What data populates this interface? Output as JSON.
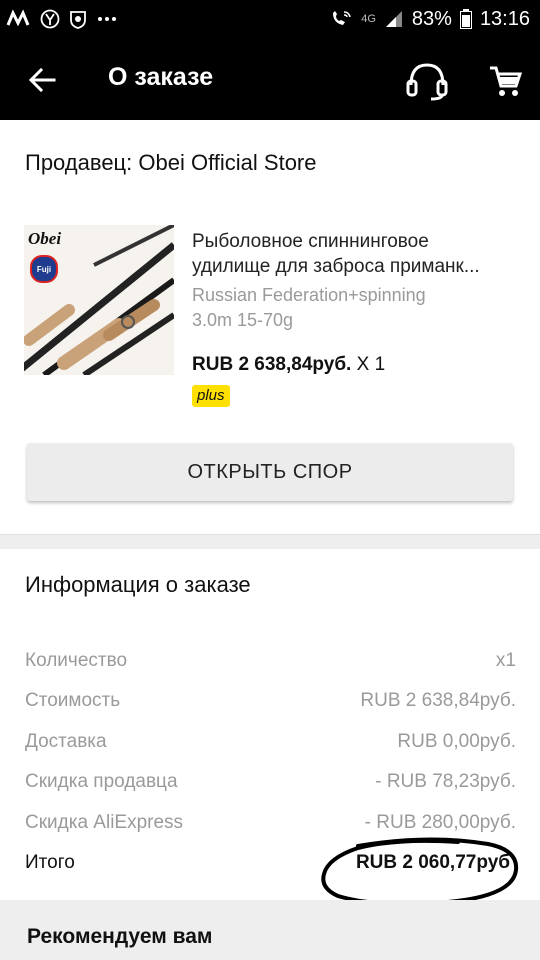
{
  "status_bar": {
    "battery": "83%",
    "time": "13:16",
    "network": "4G"
  },
  "app_bar": {
    "title": "О заказе"
  },
  "seller": {
    "label": "Продавец: Obei Official Store"
  },
  "product": {
    "title_line1": "Рыболовное спиннинговое",
    "title_line2": "удилище для заброса приманк...",
    "variant_line1": "Russian Federation+spinning",
    "variant_line2": "3.0m 15-70g",
    "price": "RUB 2 638,84руб.",
    "quantity": "X 1",
    "badge": "plus",
    "image_brand": "Obei",
    "image_badge": "Fuji"
  },
  "dispute_button": {
    "label": "ОТКРЫТЬ СПОР"
  },
  "order_info": {
    "title": "Информация о заказе",
    "rows": [
      {
        "label": "Количество",
        "value": "x1"
      },
      {
        "label": "Стоимость",
        "value": "RUB 2 638,84руб."
      },
      {
        "label": "Доставка",
        "value": "RUB 0,00руб."
      },
      {
        "label": "Скидка продавца",
        "value": "- RUB 78,23руб."
      },
      {
        "label": "Скидка AliExpress",
        "value": "- RUB 280,00руб."
      },
      {
        "label": "Итого",
        "value": "RUB 2 060,77руб"
      }
    ]
  },
  "recommend": {
    "title": "Рекомендуем вам"
  },
  "colors": {
    "app_bar": "#000000",
    "badge_yellow": "#ffe000",
    "muted_text": "#9a9a9a",
    "section_bg": "#eeeeee"
  }
}
